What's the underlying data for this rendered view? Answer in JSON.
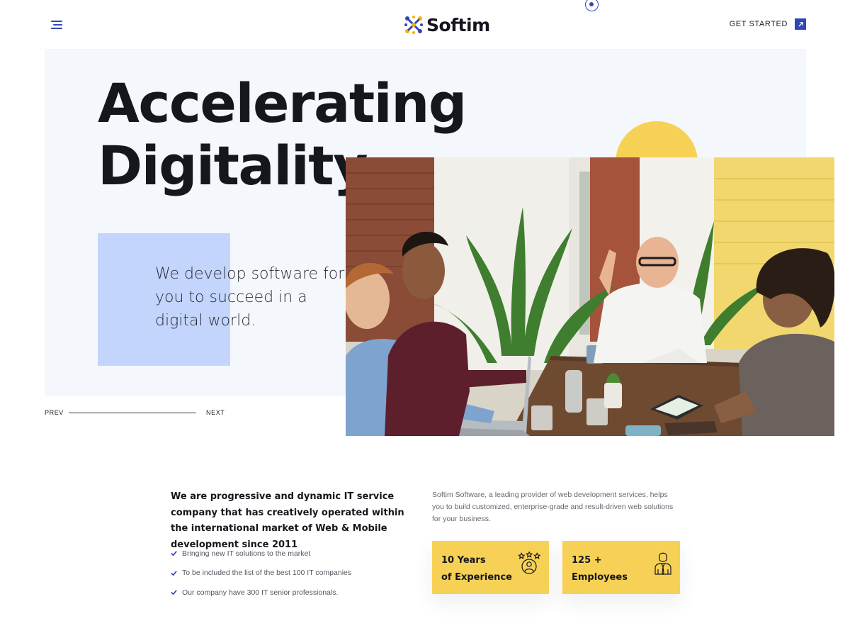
{
  "brand": {
    "name": "Softim"
  },
  "header": {
    "cta_label": "GET STARTED"
  },
  "hero": {
    "title_line_1": "Accelerating",
    "title_line_2": "Digitality",
    "subtitle": "We develop software for you to succeed in a digital world."
  },
  "slider": {
    "prev_label": "PREV",
    "next_label": "NEXT"
  },
  "about": {
    "heading": "We are progressive and dynamic IT service company that has creatively operated within the international market of Web & Mobile development since 2011",
    "checklist": [
      "Bringing new IT solutions to the market",
      "To be included the list of the best 100 IT companies",
      "Our company have 300 IT senior professionals."
    ],
    "description": "Softim Software, a leading provider of web development services, helps you to build customized, enterprise-grade and result-driven web solutions for your business."
  },
  "stats": [
    {
      "line_1": "10 Years",
      "line_2": "of Experience",
      "icon": "award-icon"
    },
    {
      "line_1": "125 +",
      "line_2": "Employees",
      "icon": "employee-icon"
    }
  ],
  "colors": {
    "accent": "#3246b8",
    "yellow": "#f7d155",
    "light_blue": "#c3d5fc",
    "hero_bg": "#f4f7fc",
    "text": "#16161d"
  }
}
